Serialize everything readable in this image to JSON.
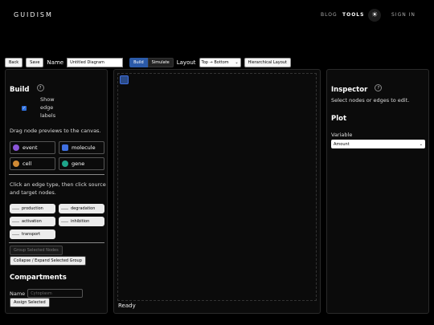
{
  "nav": {
    "logo": "GUIDISM",
    "blog": "BLOG",
    "tools": "TOOLS",
    "theme_icon": "☀",
    "signin": "SIGN IN"
  },
  "toolbar": {
    "back": "Back",
    "save": "Save",
    "name_label": "Name",
    "name_value": "Untitled Diagram",
    "build_tab": "Build",
    "simulate_tab": "Simulate",
    "layout_label": "Layout",
    "layout_value": "Top → Bottom",
    "hier_btn": "Hierarchical Layout"
  },
  "build": {
    "title": "Build",
    "help": "?",
    "show_edge": [
      "Show",
      "edge",
      "labels"
    ],
    "drag_hint": "Drag node previews to the canvas.",
    "nodes": [
      {
        "label": "event",
        "color": "#8a55d8"
      },
      {
        "label": "molecule",
        "color": "#3f6fe0"
      },
      {
        "label": "cell",
        "color": "#d08a35"
      },
      {
        "label": "gene",
        "color": "#1ea58a"
      }
    ],
    "edge_hint": [
      "Click an edge type, then click source",
      "and target nodes."
    ],
    "edges": [
      "production",
      "degradation",
      "activation",
      "inhibition",
      "transport"
    ],
    "group_btn": "Group Selected Nodes",
    "collapse_btn": "Collapse / Expand Selected Group",
    "compartments_title": "Compartments",
    "name_label": "Name",
    "name_placeholder": "Cytoplasm",
    "assign_btn": "Assign Selected"
  },
  "canvas": {
    "status": "Ready"
  },
  "inspector": {
    "title": "Inspector",
    "help": "?",
    "hint": "Select nodes or edges to edit.",
    "plot_title": "Plot",
    "variable_label": "Variable",
    "variable_value": "Amount"
  }
}
